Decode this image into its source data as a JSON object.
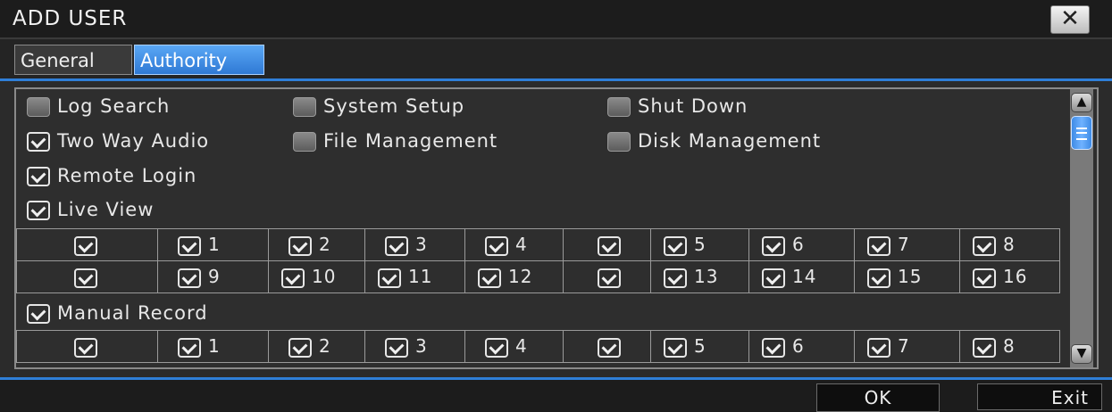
{
  "window": {
    "title": "ADD USER",
    "close_label": "✕"
  },
  "tabs": [
    {
      "label": "General",
      "active": false
    },
    {
      "label": "Authority",
      "active": true
    }
  ],
  "permissions": {
    "log_search": {
      "label": "Log Search",
      "checked": false
    },
    "system_setup": {
      "label": "System Setup",
      "checked": false
    },
    "shut_down": {
      "label": "Shut Down",
      "checked": false
    },
    "two_way_audio": {
      "label": "Two Way Audio",
      "checked": true
    },
    "file_management": {
      "label": "File Management",
      "checked": false
    },
    "disk_management": {
      "label": "Disk Management",
      "checked": false
    },
    "remote_login": {
      "label": "Remote Login",
      "checked": true
    },
    "live_view": {
      "label": "Live View",
      "checked": true
    },
    "manual_record": {
      "label": "Manual Record",
      "checked": true
    }
  },
  "live_view_channels": {
    "row1": [
      "",
      "1",
      "2",
      "3",
      "4",
      "",
      "5",
      "6",
      "7",
      "8"
    ],
    "row2": [
      "",
      "9",
      "10",
      "11",
      "12",
      "",
      "13",
      "14",
      "15",
      "16"
    ]
  },
  "manual_record_channels": {
    "row1": [
      "",
      "1",
      "2",
      "3",
      "4",
      "",
      "5",
      "6",
      "7",
      "8"
    ]
  },
  "footer": {
    "ok_label": "OK",
    "exit_label": "Exit"
  },
  "colors": {
    "accent": "#2f7fd8",
    "tab_active": "#4a96ec",
    "background": "#2b2b2b"
  }
}
